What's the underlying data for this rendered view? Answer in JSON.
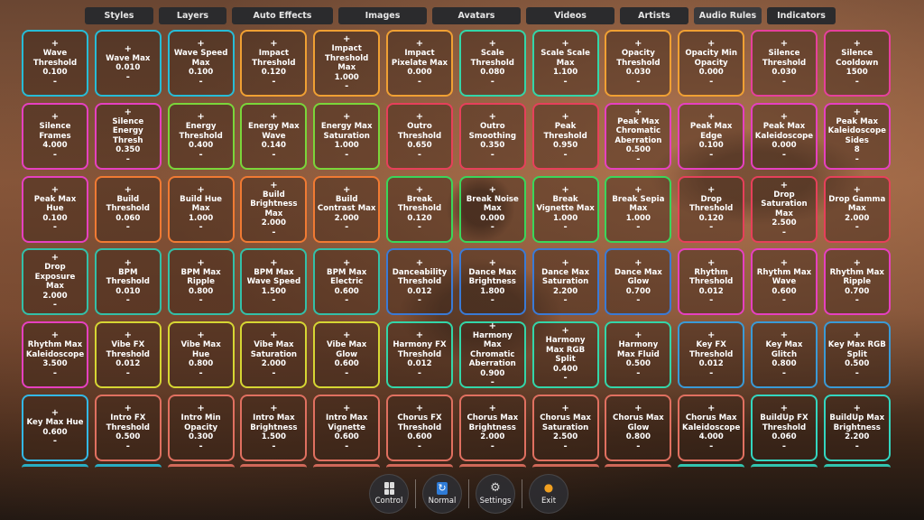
{
  "tabs": [
    {
      "label": "Styles",
      "width": 76
    },
    {
      "label": "Layers",
      "width": 75
    },
    {
      "label": "Auto Effects",
      "width": 112
    },
    {
      "label": "Images",
      "width": 98
    },
    {
      "label": "Avatars",
      "width": 98
    },
    {
      "label": "Videos",
      "width": 98
    },
    {
      "label": "Artists",
      "width": 76
    },
    {
      "label": "Audio Rules",
      "width": 75,
      "active": true
    },
    {
      "label": "Indicators",
      "width": 76
    }
  ],
  "controls": [
    {
      "label": "Wave Threshold",
      "value": "0.100",
      "color": "#27bcd6"
    },
    {
      "label": "Wave Max",
      "value": "0.010",
      "color": "#27bcd6"
    },
    {
      "label": "Wave Speed Max",
      "value": "0.100",
      "color": "#27bcd6"
    },
    {
      "label": "Impact Threshold",
      "value": "0.120",
      "color": "#f0a033"
    },
    {
      "label": "Impact Threshold Max",
      "value": "1.000",
      "color": "#f0a033"
    },
    {
      "label": "Impact Pixelate Max",
      "value": "0.000",
      "color": "#f0a033"
    },
    {
      "label": "Scale Threshold",
      "value": "0.080",
      "color": "#33d6a8"
    },
    {
      "label": "Scale Scale Max",
      "value": "1.100",
      "color": "#33d6a8"
    },
    {
      "label": "Opacity Threshold",
      "value": "0.030",
      "color": "#f0a033"
    },
    {
      "label": "Opacity Min Opacity",
      "value": "0.000",
      "color": "#f0a033"
    },
    {
      "label": "Silence Threshold",
      "value": "0.030",
      "color": "#e6409c"
    },
    {
      "label": "Silence Cooldown",
      "value": "1500",
      "color": "#e6409c"
    },
    {
      "label": "Silence Frames",
      "value": "4.000",
      "color": "#e640c0"
    },
    {
      "label": "Silence Energy Thresh",
      "value": "0.350",
      "color": "#e640c0"
    },
    {
      "label": "Energy Threshold",
      "value": "0.400",
      "color": "#7ad63a"
    },
    {
      "label": "Energy Max Wave",
      "value": "0.140",
      "color": "#7ad63a"
    },
    {
      "label": "Energy Max Saturation",
      "value": "1.000",
      "color": "#7ad63a"
    },
    {
      "label": "Outro Threshold",
      "value": "0.650",
      "color": "#e6405a"
    },
    {
      "label": "Outro Smoothing",
      "value": "0.350",
      "color": "#e6405a"
    },
    {
      "label": "Peak Threshold",
      "value": "0.950",
      "color": "#e6405a"
    },
    {
      "label": "Peak Max Chromatic Aberration",
      "value": "0.500",
      "color": "#e640c0"
    },
    {
      "label": "Peak Max Edge",
      "value": "0.100",
      "color": "#e640c0"
    },
    {
      "label": "Peak Max Kaleidoscope",
      "value": "0.000",
      "color": "#e640c0"
    },
    {
      "label": "Peak Max Kaleidoscope Sides",
      "value": "8",
      "color": "#e640c0"
    },
    {
      "label": "Peak Max Hue",
      "value": "0.100",
      "color": "#e640c0"
    },
    {
      "label": "Build Threshold",
      "value": "0.060",
      "color": "#f07a33"
    },
    {
      "label": "Build Hue Max",
      "value": "1.000",
      "color": "#f07a33"
    },
    {
      "label": "Build Brightness Max",
      "value": "2.000",
      "color": "#f07a33"
    },
    {
      "label": "Build Contrast Max",
      "value": "2.000",
      "color": "#f07a33"
    },
    {
      "label": "Break Threshold",
      "value": "0.120",
      "color": "#3ad65a"
    },
    {
      "label": "Break Noise Max",
      "value": "0.000",
      "color": "#3ad65a"
    },
    {
      "label": "Break Vignette Max",
      "value": "1.000",
      "color": "#3ad65a"
    },
    {
      "label": "Break Sepia Max",
      "value": "1.000",
      "color": "#3ad65a"
    },
    {
      "label": "Drop Threshold",
      "value": "0.120",
      "color": "#e6405a"
    },
    {
      "label": "Drop Saturation Max",
      "value": "2.500",
      "color": "#e6405a"
    },
    {
      "label": "Drop Gamma Max",
      "value": "2.000",
      "color": "#e6405a"
    },
    {
      "label": "Drop Exposure Max",
      "value": "2.000",
      "color": "#33c0a8"
    },
    {
      "label": "BPM Threshold",
      "value": "0.010",
      "color": "#33c0a8"
    },
    {
      "label": "BPM Max Ripple",
      "value": "0.800",
      "color": "#33c0a8"
    },
    {
      "label": "BPM Max Wave Speed",
      "value": "1.500",
      "color": "#33c0a8"
    },
    {
      "label": "BPM Max Electric",
      "value": "0.600",
      "color": "#33c0a8"
    },
    {
      "label": "Danceability Threshold",
      "value": "0.012",
      "color": "#3a7ad6"
    },
    {
      "label": "Dance Max Brightness",
      "value": "1.800",
      "color": "#3a7ad6"
    },
    {
      "label": "Dance Max Saturation",
      "value": "2.200",
      "color": "#3a7ad6"
    },
    {
      "label": "Dance Max Glow",
      "value": "0.700",
      "color": "#3a7ad6"
    },
    {
      "label": "Rhythm Threshold",
      "value": "0.012",
      "color": "#e640c0"
    },
    {
      "label": "Rhythm Max Wave",
      "value": "0.600",
      "color": "#e640c0"
    },
    {
      "label": "Rhythm Max Ripple",
      "value": "0.700",
      "color": "#e640c0"
    },
    {
      "label": "Rhythm Max Kaleidoscope",
      "value": "3.500",
      "color": "#e640c0"
    },
    {
      "label": "Vibe FX Threshold",
      "value": "0.012",
      "color": "#d6d633"
    },
    {
      "label": "Vibe Max Hue",
      "value": "0.800",
      "color": "#d6d633"
    },
    {
      "label": "Vibe Max Saturation",
      "value": "2.000",
      "color": "#d6d633"
    },
    {
      "label": "Vibe Max Glow",
      "value": "0.600",
      "color": "#d6d633"
    },
    {
      "label": "Harmony FX Threshold",
      "value": "0.012",
      "color": "#33d6a8"
    },
    {
      "label": "Harmony Max Chromatic Aberration",
      "value": "0.900",
      "color": "#33d6a8"
    },
    {
      "label": "Harmony Max RGB Split",
      "value": "0.400",
      "color": "#33d6a8"
    },
    {
      "label": "Harmony Max Fluid",
      "value": "0.500",
      "color": "#33d6a8"
    },
    {
      "label": "Key FX Threshold",
      "value": "0.012",
      "color": "#3a9ad6"
    },
    {
      "label": "Key Max Glitch",
      "value": "0.800",
      "color": "#3a9ad6"
    },
    {
      "label": "Key Max RGB Split",
      "value": "0.500",
      "color": "#3a9ad6"
    },
    {
      "label": "Key Max Hue",
      "value": "0.600",
      "color": "#33b8e6"
    },
    {
      "label": "Intro FX Threshold",
      "value": "0.500",
      "color": "#e07060"
    },
    {
      "label": "Intro Min Opacity",
      "value": "0.300",
      "color": "#e07060"
    },
    {
      "label": "Intro Max Brightness",
      "value": "1.500",
      "color": "#e07060"
    },
    {
      "label": "Intro Max Vignette",
      "value": "0.600",
      "color": "#e07060"
    },
    {
      "label": "Chorus FX Threshold",
      "value": "0.600",
      "color": "#e07060"
    },
    {
      "label": "Chorus Max Brightness",
      "value": "2.000",
      "color": "#e07060"
    },
    {
      "label": "Chorus Max Saturation",
      "value": "2.500",
      "color": "#e07060"
    },
    {
      "label": "Chorus Max Glow",
      "value": "0.800",
      "color": "#e07060"
    },
    {
      "label": "Chorus Max Kaleidoscope",
      "value": "4.000",
      "color": "#e07060"
    },
    {
      "label": "BuildUp FX Threshold",
      "value": "0.060",
      "color": "#33d6c0"
    },
    {
      "label": "BuildUp Max Brightness",
      "value": "2.200",
      "color": "#33d6c0"
    }
  ],
  "partial_row_colors": [
    "#27bcd6",
    "#27bcd6",
    "#e07060",
    "#e07060",
    "#e07060",
    "#e07060",
    "#e07060",
    "#e07060",
    "#e07060",
    "#33d6c0",
    "#33d6c0",
    "#33d6c0"
  ],
  "dock": {
    "control_label": "Control",
    "normal_label": "Normal",
    "settings_label": "Settings",
    "exit_label": "Exit"
  }
}
